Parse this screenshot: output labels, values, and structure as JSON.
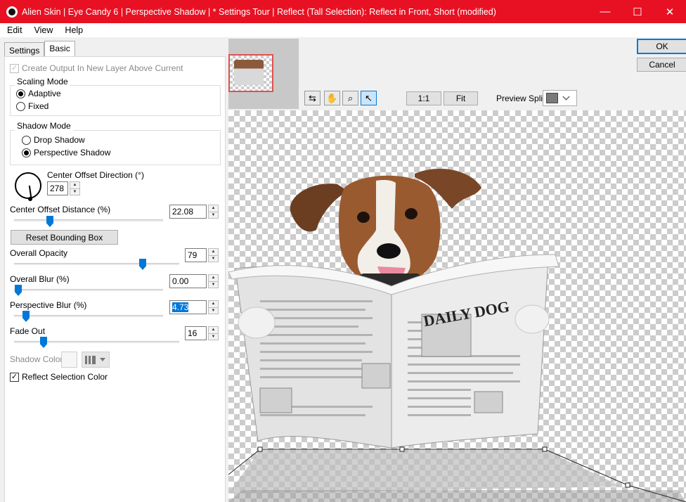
{
  "window": {
    "title": "Alien Skin | Eye Candy 6 | Perspective Shadow | * Settings Tour | Reflect (Tall Selection): Reflect in Front, Short (modified)",
    "titlebar_color": "#e81123",
    "controls": {
      "minimize": "—",
      "maximize": "☐",
      "close": "✕"
    }
  },
  "menu": {
    "items": [
      "Edit",
      "View",
      "Help"
    ]
  },
  "tabs": {
    "settings": "Settings",
    "basic": "Basic"
  },
  "basic": {
    "create_output": {
      "label": "Create Output In New Layer Above Current",
      "checked": true,
      "enabled": false
    },
    "scaling_mode": {
      "title": "Scaling Mode",
      "adaptive": "Adaptive",
      "fixed": "Fixed",
      "selected": "Adaptive"
    },
    "shadow_mode": {
      "title": "Shadow Mode",
      "drop": "Drop Shadow",
      "perspective": "Perspective Shadow",
      "selected": "Perspective Shadow"
    },
    "center_offset_direction": {
      "label": "Center Offset Direction (°)",
      "value": "278"
    },
    "center_offset_distance": {
      "label": "Center Offset Distance (%)",
      "value": "22.08"
    },
    "reset_bounding_box": "Reset Bounding Box",
    "overall_opacity": {
      "label": "Overall Opacity",
      "value": "79"
    },
    "overall_blur": {
      "label": "Overall Blur (%)",
      "value": "0.00"
    },
    "perspective_blur": {
      "label": "Perspective Blur (%)",
      "value": "4.73"
    },
    "fade_out": {
      "label": "Fade Out",
      "value": "16"
    },
    "shadow_color": {
      "label": "Shadow Color",
      "enabled": false
    },
    "reflect_selection_color": {
      "label": "Reflect Selection Color",
      "checked": true
    }
  },
  "buttons": {
    "ok": "OK",
    "cancel": "Cancel"
  },
  "toolbar": {
    "zoom_1_1": "1:1",
    "fit": "Fit",
    "preview_split_label": "Preview Split:",
    "tools": [
      "compare-icon",
      "hand-icon",
      "zoom-icon",
      "pointer-icon"
    ]
  },
  "preview": {
    "newspaper_title": "DAILY DOG",
    "accent": "#0078d7"
  }
}
